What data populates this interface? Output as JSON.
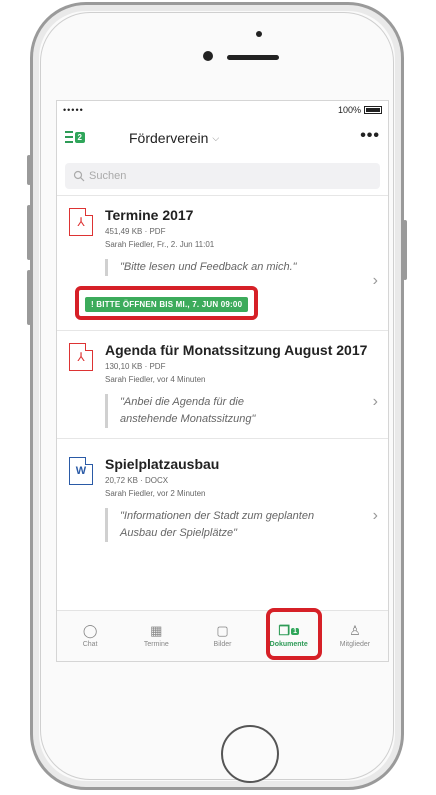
{
  "status": {
    "signal": "•••••",
    "wifi": "wifi-icon",
    "battery_text": "100%",
    "battery_level": 1.0
  },
  "navbar": {
    "badge": "2",
    "title": "Förderverein",
    "chevron": "⌵",
    "more": "•••"
  },
  "search": {
    "placeholder": "Suchen"
  },
  "items": [
    {
      "icon": "pdf-icon",
      "title": "Termine 2017",
      "meta": "451,49 KB · PDF",
      "author": "Sarah Fiedler, Fr., 2. Jun 11:01",
      "quote": "\"Bitte lesen und Feedback an mich.\"",
      "due": "! BITTE ÖFFNEN BIS MI., 7. JUN 09:00"
    },
    {
      "icon": "pdf-icon",
      "title": "Agenda für Monatssitzung August 2017",
      "meta": "130,10 KB · PDF",
      "author": "Sarah Fiedler, vor 4 Minuten",
      "quote": "\"Anbei die Agenda für die anstehende Monatssitzung\""
    },
    {
      "icon": "word-icon",
      "icon_label": "W",
      "title": "Spielplatzausbau",
      "meta": "20,72 KB · DOCX",
      "author": "Sarah Fiedler, vor 2 Minuten",
      "quote": "\"Informationen der Stadt zum geplanten Ausbau der Spielplätze\""
    }
  ],
  "tabs": [
    {
      "label": "Chat",
      "icon": "chat-icon"
    },
    {
      "label": "Termine",
      "icon": "calendar-icon"
    },
    {
      "label": "Bilder",
      "icon": "image-icon"
    },
    {
      "label": "Dokumente",
      "icon": "documents-icon",
      "badge": "1",
      "active": true
    },
    {
      "label": "Mitglieder",
      "icon": "members-icon"
    }
  ],
  "colors": {
    "accent": "#2e9b57",
    "highlight": "#d62027",
    "pdf": "#d33333",
    "word": "#2a5aa6"
  }
}
